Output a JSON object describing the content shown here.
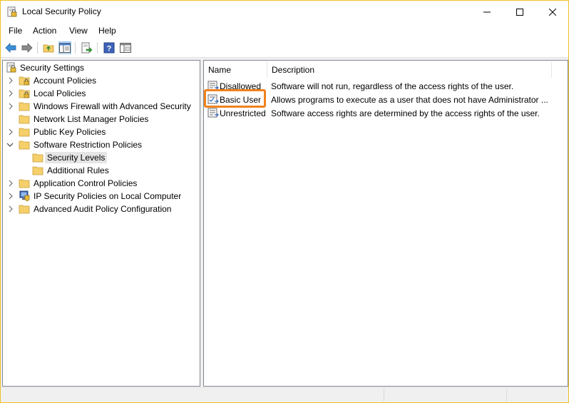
{
  "window": {
    "title": "Local Security Policy"
  },
  "menu": {
    "items": [
      "File",
      "Action",
      "View",
      "Help"
    ]
  },
  "toolbar": {
    "buttons": [
      "back-arrow-icon",
      "forward-arrow-icon",
      "up-folder-icon",
      "show-hide-tree-icon",
      "export-list-icon",
      "help-icon",
      "properties-icon"
    ]
  },
  "tree": {
    "root": "Security Settings",
    "items": [
      {
        "label": "Account Policies",
        "icon": "folder-lock-icon",
        "expandable": true
      },
      {
        "label": "Local Policies",
        "icon": "folder-lock-icon",
        "expandable": true
      },
      {
        "label": "Windows Firewall with Advanced Security",
        "icon": "folder-icon",
        "expandable": true
      },
      {
        "label": "Network List Manager Policies",
        "icon": "folder-icon",
        "expandable": false
      },
      {
        "label": "Public Key Policies",
        "icon": "folder-icon",
        "expandable": true
      },
      {
        "label": "Software Restriction Policies",
        "icon": "folder-icon",
        "expandable": true,
        "expanded": true
      },
      {
        "label": "Security Levels",
        "icon": "folder-icon",
        "child": true,
        "selected": true
      },
      {
        "label": "Additional Rules",
        "icon": "folder-icon",
        "child": true
      },
      {
        "label": "Application Control Policies",
        "icon": "folder-icon",
        "expandable": true
      },
      {
        "label": "IP Security Policies on Local Computer",
        "icon": "ip-security-icon",
        "expandable": true
      },
      {
        "label": "Advanced Audit Policy Configuration",
        "icon": "folder-icon",
        "expandable": true
      }
    ]
  },
  "list": {
    "columns": [
      "Name",
      "Description"
    ],
    "rows": [
      {
        "name": "Disallowed",
        "description": "Software will not run, regardless of the access rights of the user.",
        "default": false
      },
      {
        "name": "Basic User",
        "description": "Allows programs to execute as a user that does not have Administrator ...",
        "default": true
      },
      {
        "name": "Unrestricted",
        "description": "Software access rights are determined by the access rights of the user.",
        "default": false
      }
    ]
  },
  "colors": {
    "highlight": "#f0821e",
    "selection": "#e5e5e5",
    "folder": "#f5cf6a"
  }
}
